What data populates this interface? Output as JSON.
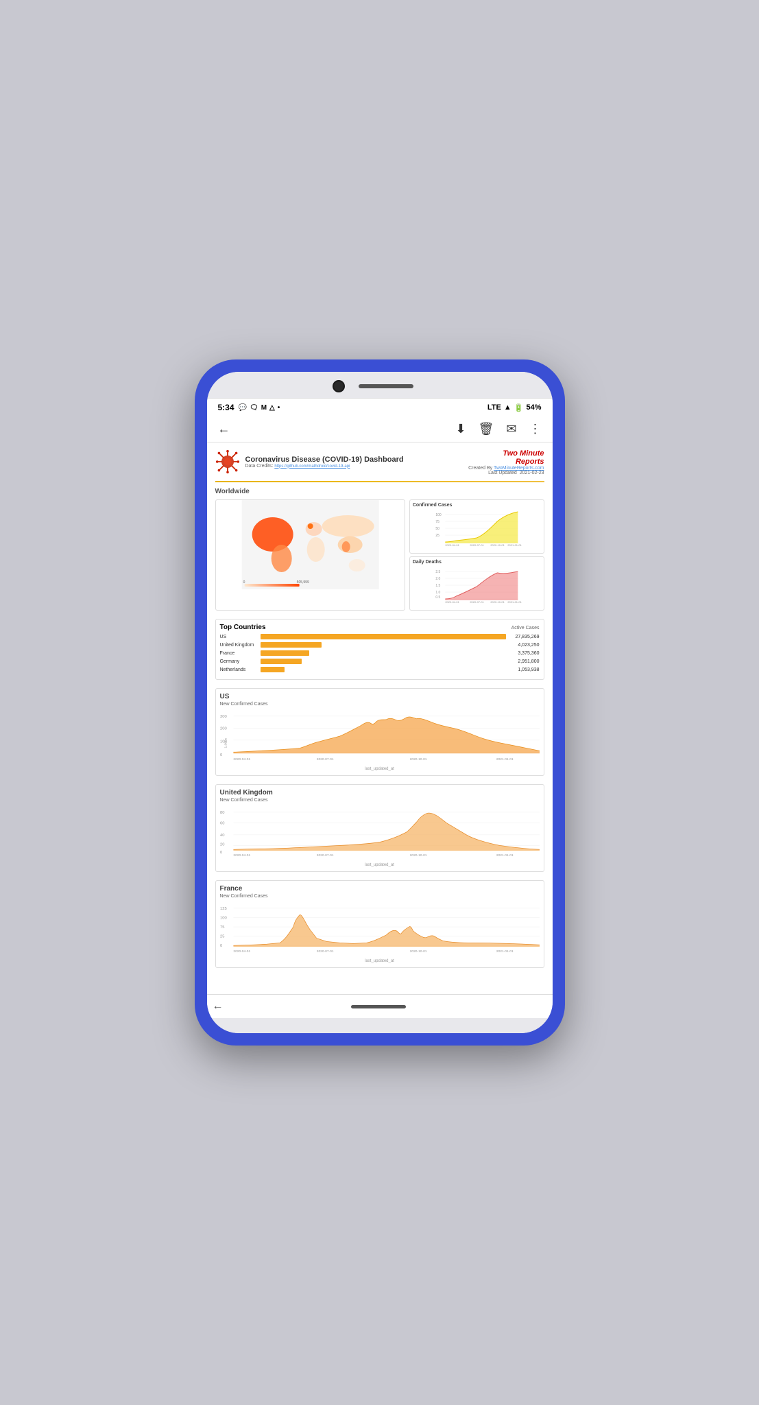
{
  "phone": {
    "time": "5:34",
    "battery": "54%",
    "signal": "LTE"
  },
  "header": {
    "back_icon": "←",
    "download_icon": "⬇",
    "delete_icon": "🗑",
    "mail_icon": "✉",
    "more_icon": "⋮"
  },
  "dashboard": {
    "title": "Coronavirus Disease (COVID-19) Dashboard",
    "data_credit_label": "Data Credits:",
    "data_credit_link": "https://github.com/mathdroid/covid-19-api",
    "brand_name": "Two Minute\nReports",
    "created_by_label": "Created By",
    "created_by_link": "TwoMinuteReports.com",
    "last_updated_label": "Last Updated",
    "last_updated_date": "2021-02-23",
    "worldwide_label": "Worldwide",
    "confirmed_cases_label": "Confirmed Cases",
    "daily_deaths_label": "Daily Deaths",
    "top_countries_label": "Top Countries",
    "active_cases_label": "Active Cases",
    "countries": [
      {
        "name": "US",
        "value": "27,835,269",
        "bar_pct": 100,
        "color": "#f5a623"
      },
      {
        "name": "United Kingdom",
        "value": "4,023,250",
        "bar_pct": 25,
        "color": "#f5a623"
      },
      {
        "name": "France",
        "value": "3,375,360",
        "bar_pct": 20,
        "color": "#f5a623"
      },
      {
        "name": "Germany",
        "value": "2,951,800",
        "bar_pct": 17,
        "color": "#f5a623"
      },
      {
        "name": "Netherlands",
        "value": "1,053,938",
        "bar_pct": 10,
        "color": "#f5a623"
      }
    ],
    "us_section_label": "US",
    "us_chart_label": "New Confirmed Cases",
    "us_x_label": "last_updated_at",
    "uk_section_label": "United Kingdom",
    "uk_chart_label": "New Confirmed Cases",
    "uk_x_label": "last_updated_at",
    "france_section_label": "France",
    "france_chart_label": "New Confirmed Cases",
    "france_x_label": "last_updated_at",
    "date_labels": [
      "2020-04-01",
      "2020-07-01",
      "2020-10-01",
      "2021-01-01"
    ]
  }
}
